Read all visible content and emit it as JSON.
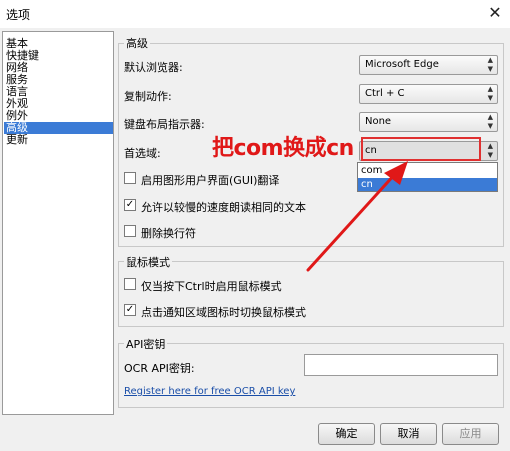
{
  "window": {
    "title": "选项"
  },
  "sidebar": {
    "items": [
      {
        "label": "基本",
        "selected": false
      },
      {
        "label": "快捷键",
        "selected": false
      },
      {
        "label": "网络",
        "selected": false
      },
      {
        "label": "服务",
        "selected": false
      },
      {
        "label": "语言",
        "selected": false
      },
      {
        "label": "外观",
        "selected": false
      },
      {
        "label": "例外",
        "selected": false
      },
      {
        "label": "高级",
        "selected": true
      },
      {
        "label": "更新",
        "selected": false
      }
    ]
  },
  "advanced": {
    "legend": "高级",
    "default_browser": {
      "label": "默认浏览器:",
      "value": "Microsoft Edge"
    },
    "copy_action": {
      "label": "复制动作:",
      "value": "Ctrl + C"
    },
    "keyboard_layout": {
      "label": "键盘布局指示器:",
      "value": "None"
    },
    "preferred_domain": {
      "label": "首选域:",
      "value": "cn",
      "options": [
        {
          "label": "com",
          "highlighted": false
        },
        {
          "label": "cn",
          "highlighted": true
        }
      ]
    },
    "checkboxes": [
      {
        "label": "启用图形用户界面(GUI)翻译",
        "checked": false
      },
      {
        "label": "允许以较慢的速度朗读相同的文本",
        "checked": true
      },
      {
        "label": "删除换行符",
        "checked": false
      }
    ]
  },
  "mouse_mode": {
    "legend": "鼠标模式",
    "checkboxes": [
      {
        "label": "仅当按下Ctrl时启用鼠标模式",
        "checked": false
      },
      {
        "label": "点击通知区域图标时切换鼠标模式",
        "checked": true
      }
    ]
  },
  "api_key": {
    "legend": "API密钥",
    "ocr_label": "OCR API密钥:",
    "ocr_value": "",
    "register_link": "Register here for free OCR API key"
  },
  "buttons": {
    "ok": "确定",
    "cancel": "取消",
    "apply": "应用"
  },
  "annotation": {
    "text": "把com换成cn",
    "color": "#e01818"
  },
  "icons": {
    "close": "close-icon",
    "check": "check-icon",
    "combo_arrow": "updown-arrow-icon"
  }
}
